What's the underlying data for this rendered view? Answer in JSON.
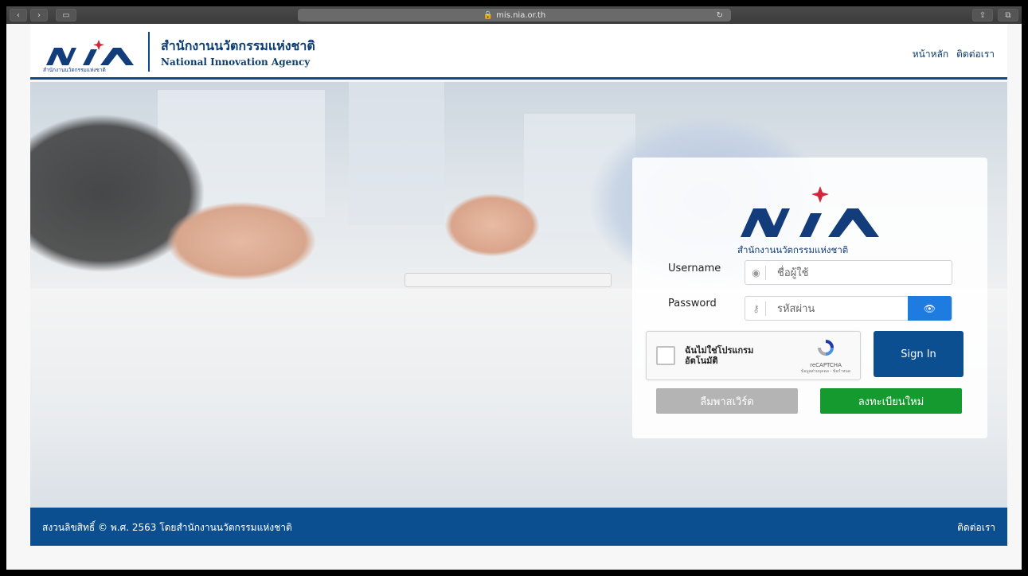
{
  "browser": {
    "url": "mis.nia.or.th",
    "back_glyph": "‹",
    "forward_glyph": "›",
    "sidebar_glyph": "▭",
    "reload_glyph": "↻",
    "share_glyph": "⇪",
    "tabs_glyph": "⧉"
  },
  "header": {
    "logo_caption": "สำนักงานนวัตกรรมแห่งชาติ",
    "org_name_th": "สำนักงานนวัตกรรมแห่งชาติ",
    "org_name_en": "National Innovation Agency",
    "nav": [
      "หน้าหลัก",
      "ติดต่อเรา"
    ]
  },
  "login": {
    "logo_caption": "สำนักงานนวัตกรรมแห่งชาติ",
    "username_label": "Username",
    "username_placeholder": "ชื่อผู้ใช้",
    "password_label": "Password",
    "password_placeholder": "รหัสผ่าน",
    "user_icon": "person-circle-icon",
    "key_icon": "key-icon",
    "eye_icon": "eye-slash-icon",
    "captcha_text_line1": "ฉันไม่ใช่โปรแกรม",
    "captcha_text_line2": "อัตโนมัติ",
    "captcha_brand": "reCAPTCHA",
    "captcha_links": "ข้อมูลส่วนบุคคล - ข้อกำหนด",
    "signin_label": "Sign In",
    "forgot_label": "ลืมพาสเวิร์ด",
    "register_label": "ลงทะเบียนใหม่"
  },
  "footer": {
    "copyright": "สงวนลิขสิทธิ์ © พ.ศ. 2563 โดยสำนักงานนวัตกรรมแห่งชาติ",
    "contact": "ติดต่อเรา"
  },
  "colors": {
    "brand_navy": "#0c4f91",
    "brand_dark": "#0c3d73",
    "star_red": "#d3263a",
    "eye_button": "#1e7be0",
    "register_green": "#149a2e",
    "forgot_gray": "#b4b4b4"
  }
}
